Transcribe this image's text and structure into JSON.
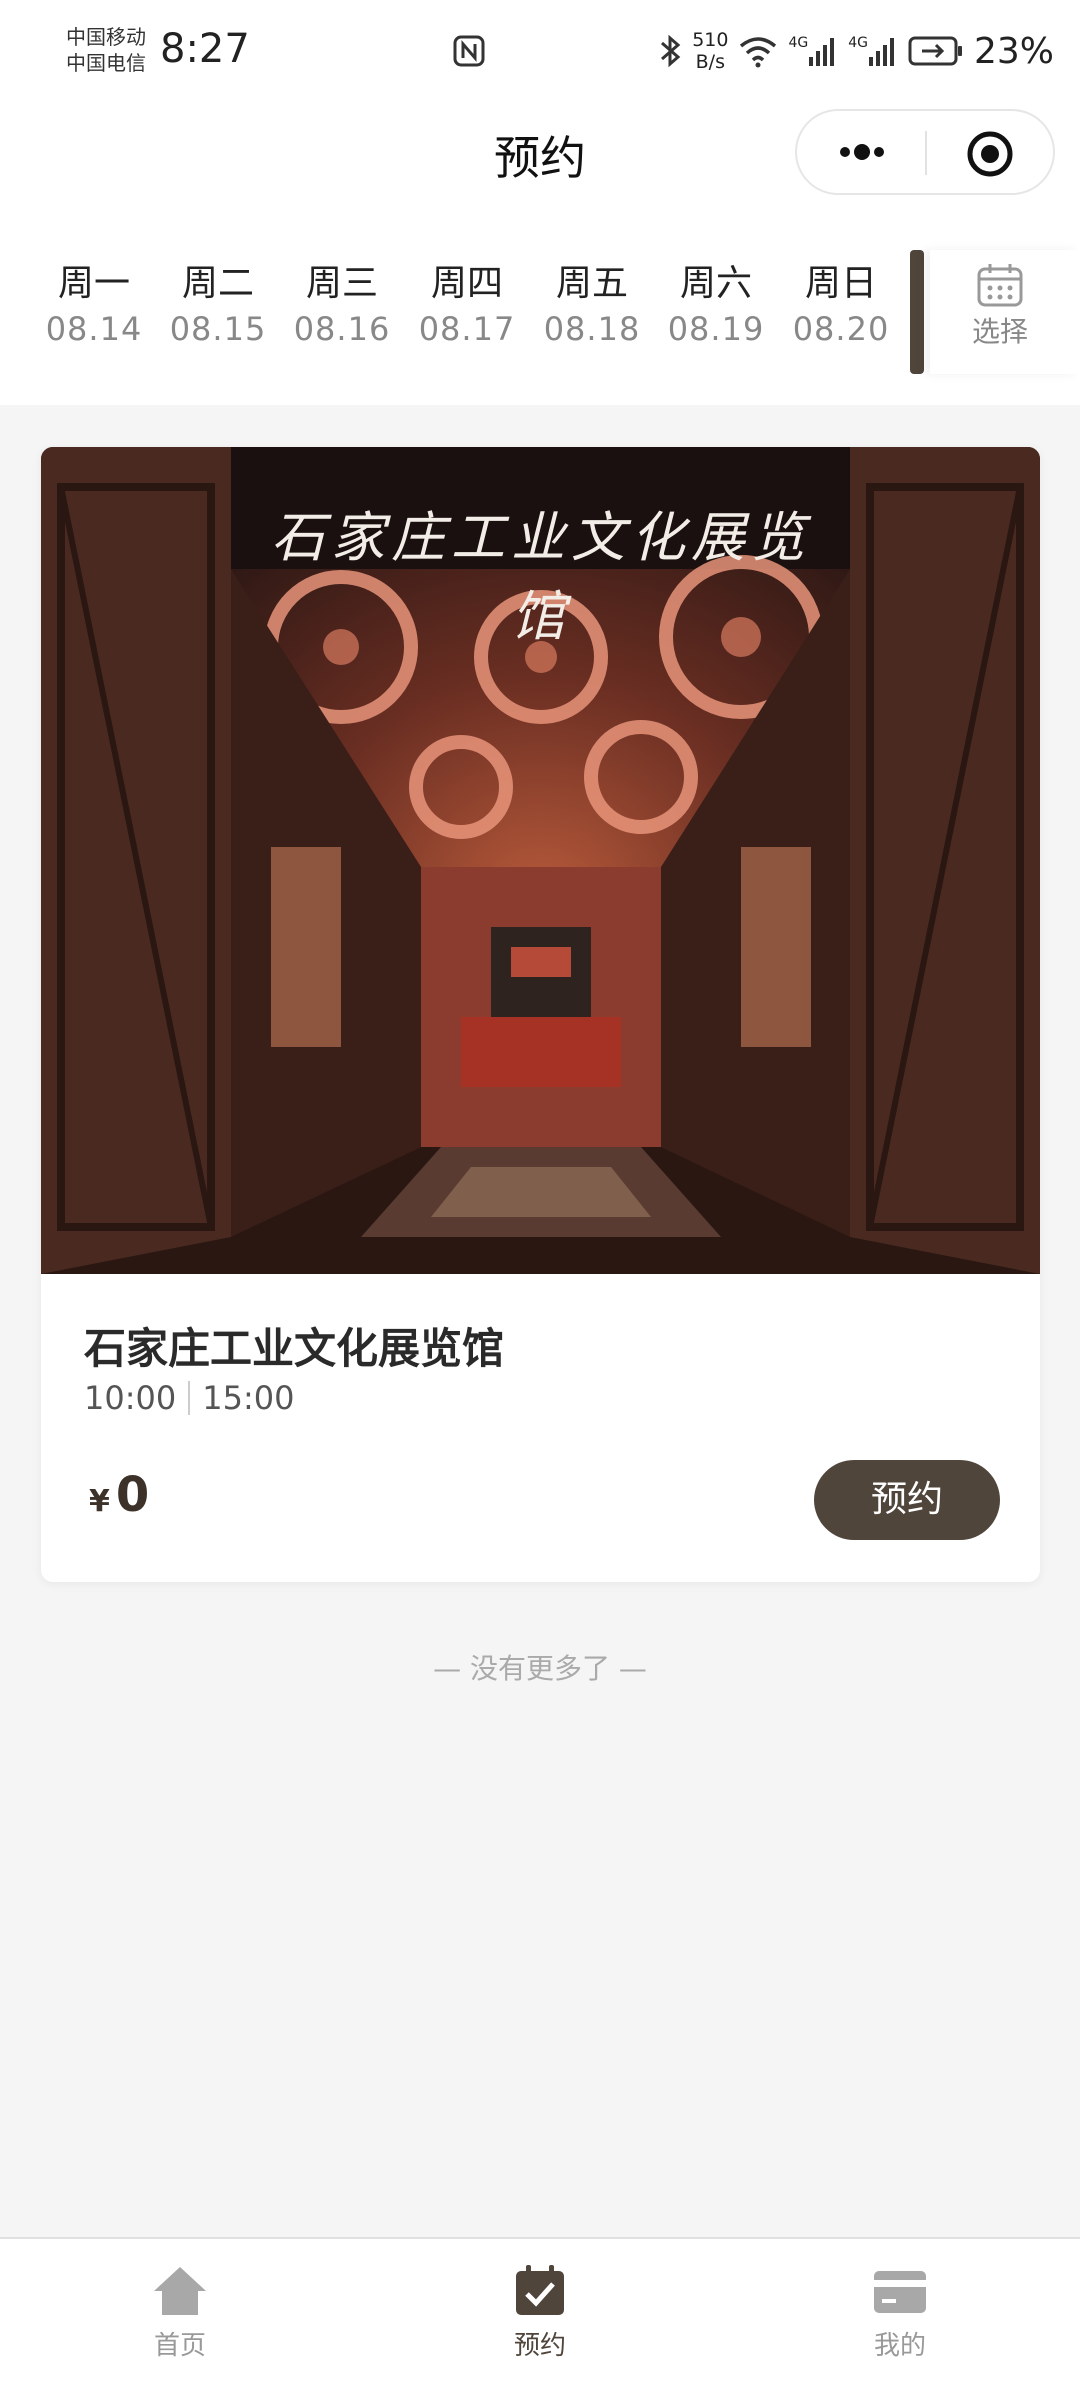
{
  "status_bar": {
    "carrier_1": "中国移动",
    "carrier_2": "中国电信",
    "time": "8:27",
    "speed_value": "510",
    "speed_unit": "B/s",
    "network_1": "4G",
    "network_2": "4G",
    "battery": "23%"
  },
  "nav": {
    "title": "预约"
  },
  "dates": [
    {
      "weekday": "周一",
      "date": "08.14"
    },
    {
      "weekday": "周二",
      "date": "08.15"
    },
    {
      "weekday": "周三",
      "date": "08.16"
    },
    {
      "weekday": "周四",
      "date": "08.17"
    },
    {
      "weekday": "周五",
      "date": "08.18"
    },
    {
      "weekday": "周六",
      "date": "08.19"
    },
    {
      "weekday": "周日",
      "date": "08.20"
    }
  ],
  "calendar": {
    "label": "选择"
  },
  "venue": {
    "image_caption": "石家庄工业文化展览馆",
    "name": "石家庄工业文化展览馆",
    "time_1": "10:00",
    "time_2": "15:00",
    "currency": "¥",
    "price": "0",
    "book_label": "预约"
  },
  "list_end": "— 没有更多了 —",
  "tabs": [
    {
      "label": "首页",
      "icon": "home-icon"
    },
    {
      "label": "预约",
      "icon": "calendar-check-icon"
    },
    {
      "label": "我的",
      "icon": "card-icon"
    }
  ],
  "colors": {
    "accent": "#50453b",
    "background": "#f5f5f5",
    "muted_text": "#888888"
  }
}
